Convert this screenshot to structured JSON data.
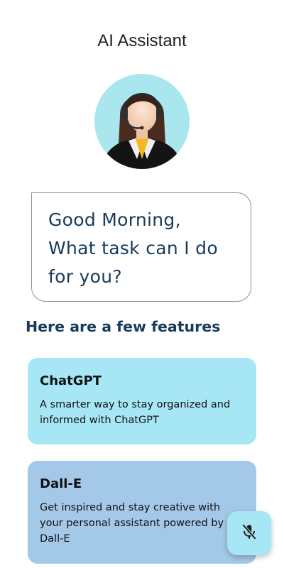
{
  "header": {
    "title": "AI Assistant"
  },
  "avatar": {
    "icon": "assistant-avatar-icon"
  },
  "greeting": {
    "line1": "Good Morning,",
    "line2": "What task can I do",
    "line3": "for you?"
  },
  "features": {
    "heading": "Here are a few features",
    "cards": [
      {
        "title": "ChatGPT",
        "desc_line1": "A smarter way to stay organized and",
        "desc_line2": "informed with ChatGPT",
        "color": "#a6e6f5"
      },
      {
        "title": "Dall-E",
        "desc_line1": "Get inspired and stay creative with",
        "desc_line2": "your personal assistant powered by",
        "desc_line3": "Dall-E",
        "color": "#a3c8e8"
      }
    ]
  },
  "mic_button": {
    "icon": "mic-off-icon",
    "color": "#a6e6f5"
  },
  "colors": {
    "heading_text": "#173b59",
    "bubble_border": "#8f8f8f"
  }
}
